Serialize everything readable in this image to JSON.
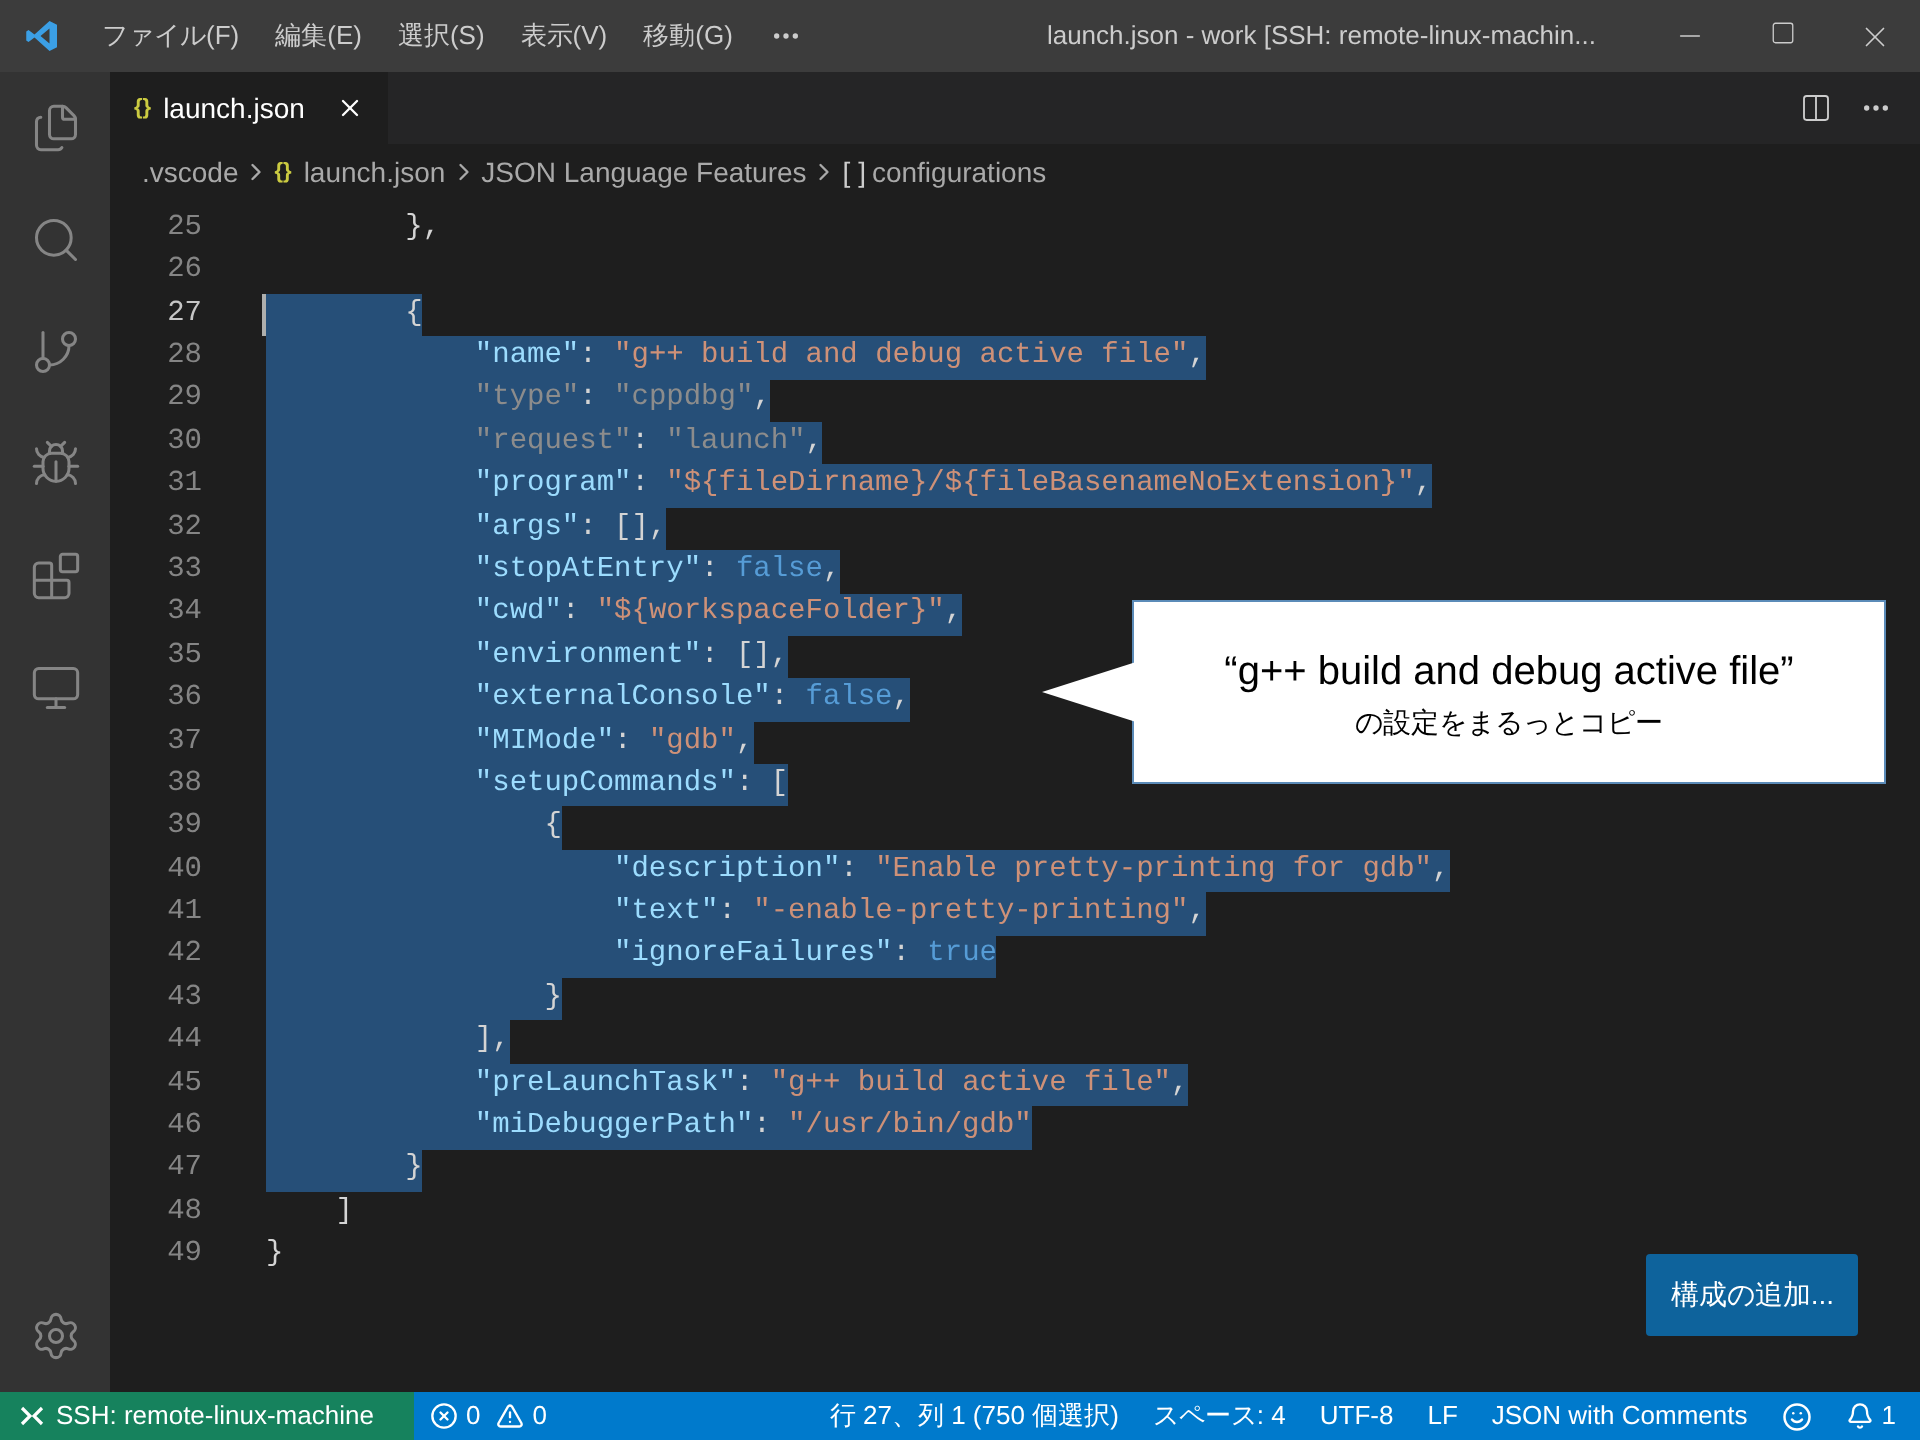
{
  "menu": [
    "ファイル(F)",
    "編集(E)",
    "選択(S)",
    "表示(V)",
    "移動(G)"
  ],
  "window": {
    "title": "launch.json - work [SSH: remote-linux-machin..."
  },
  "tabs": [
    {
      "label": "launch.json",
      "icon": "{}",
      "selected": true
    }
  ],
  "breadcrumbs": [
    {
      "label": ".vscode"
    },
    {
      "label": "launch.json",
      "icon": "{}"
    },
    {
      "label": "JSON Language Features"
    },
    {
      "label": "configurations",
      "icon": "[ ]"
    }
  ],
  "lines": [
    {
      "number": "25",
      "current": false,
      "selected": false,
      "tokens": [
        {
          "kind": "punct",
          "text": "        },"
        }
      ]
    },
    {
      "number": "26",
      "current": false,
      "selected": false
    },
    {
      "number": "27",
      "current": true,
      "selected": true,
      "tokens": [
        {
          "kind": "punct",
          "text": "        {"
        }
      ]
    },
    {
      "number": "28",
      "current": false,
      "selected": true,
      "tokens": [
        {
          "kind": "key",
          "text": "            \"name\""
        },
        {
          "kind": "punct",
          "text": ": "
        },
        {
          "kind": "string",
          "text": "\"g++ build and debug active file\""
        },
        {
          "kind": "punct",
          "text": ","
        }
      ]
    },
    {
      "number": "29",
      "current": false,
      "selected": true,
      "tokens": [
        {
          "kind": "dim",
          "text": "            \"type\""
        },
        {
          "kind": "punct",
          "text": ": "
        },
        {
          "kind": "dim",
          "text": "\"cppdbg\""
        },
        {
          "kind": "punct",
          "text": ","
        }
      ]
    },
    {
      "number": "30",
      "current": false,
      "selected": true,
      "tokens": [
        {
          "kind": "dim",
          "text": "            \"request\""
        },
        {
          "kind": "punct",
          "text": ": "
        },
        {
          "kind": "dim",
          "text": "\"launch\""
        },
        {
          "kind": "punct",
          "text": ","
        }
      ]
    },
    {
      "number": "31",
      "current": false,
      "selected": true,
      "tokens": [
        {
          "kind": "key",
          "text": "            \"program\""
        },
        {
          "kind": "punct",
          "text": ": "
        },
        {
          "kind": "string",
          "text": "\"${fileDirname}/${fileBasenameNoExtension}\""
        },
        {
          "kind": "punct",
          "text": ","
        }
      ]
    },
    {
      "number": "32",
      "current": false,
      "selected": true,
      "tokens": [
        {
          "kind": "key",
          "text": "            \"args\""
        },
        {
          "kind": "punct",
          "text": ": [],"
        }
      ]
    },
    {
      "number": "33",
      "current": false,
      "selected": true,
      "tokens": [
        {
          "kind": "key",
          "text": "            \"stopAtEntry\""
        },
        {
          "kind": "punct",
          "text": ": "
        },
        {
          "kind": "keyword",
          "text": "false"
        },
        {
          "kind": "punct",
          "text": ","
        }
      ]
    },
    {
      "number": "34",
      "current": false,
      "selected": true,
      "tokens": [
        {
          "kind": "key",
          "text": "            \"cwd\""
        },
        {
          "kind": "punct",
          "text": ": "
        },
        {
          "kind": "string",
          "text": "\"${workspaceFolder}\""
        },
        {
          "kind": "punct",
          "text": ","
        }
      ]
    },
    {
      "number": "35",
      "current": false,
      "selected": true,
      "tokens": [
        {
          "kind": "key",
          "text": "            \"environment\""
        },
        {
          "kind": "punct",
          "text": ": [],"
        }
      ]
    },
    {
      "number": "36",
      "current": false,
      "selected": true,
      "tokens": [
        {
          "kind": "key",
          "text": "            \"externalConsole\""
        },
        {
          "kind": "punct",
          "text": ": "
        },
        {
          "kind": "keyword",
          "text": "false"
        },
        {
          "kind": "punct",
          "text": ","
        }
      ]
    },
    {
      "number": "37",
      "current": false,
      "selected": true,
      "tokens": [
        {
          "kind": "key",
          "text": "            \"MIMode\""
        },
        {
          "kind": "punct",
          "text": ": "
        },
        {
          "kind": "string",
          "text": "\"gdb\""
        },
        {
          "kind": "punct",
          "text": ","
        }
      ]
    },
    {
      "number": "38",
      "current": false,
      "selected": true,
      "tokens": [
        {
          "kind": "key",
          "text": "            \"setupCommands\""
        },
        {
          "kind": "punct",
          "text": ": ["
        }
      ]
    },
    {
      "number": "39",
      "current": false,
      "selected": true,
      "tokens": [
        {
          "kind": "punct",
          "text": "                {"
        }
      ]
    },
    {
      "number": "40",
      "current": false,
      "selected": true,
      "tokens": [
        {
          "kind": "key",
          "text": "                    \"description\""
        },
        {
          "kind": "punct",
          "text": ": "
        },
        {
          "kind": "string",
          "text": "\"Enable pretty-printing for gdb\""
        },
        {
          "kind": "punct",
          "text": ","
        }
      ]
    },
    {
      "number": "41",
      "current": false,
      "selected": true,
      "tokens": [
        {
          "kind": "key",
          "text": "                    \"text\""
        },
        {
          "kind": "punct",
          "text": ": "
        },
        {
          "kind": "string",
          "text": "\"-enable-pretty-printing\""
        },
        {
          "kind": "punct",
          "text": ","
        }
      ]
    },
    {
      "number": "42",
      "current": false,
      "selected": true,
      "tokens": [
        {
          "kind": "key",
          "text": "                    \"ignoreFailures\""
        },
        {
          "kind": "punct",
          "text": ": "
        },
        {
          "kind": "keyword",
          "text": "true"
        }
      ]
    },
    {
      "number": "43",
      "current": false,
      "selected": true,
      "tokens": [
        {
          "kind": "punct",
          "text": "                }"
        }
      ]
    },
    {
      "number": "44",
      "current": false,
      "selected": true,
      "tokens": [
        {
          "kind": "punct",
          "text": "            ],"
        }
      ]
    },
    {
      "number": "45",
      "current": false,
      "selected": true,
      "tokens": [
        {
          "kind": "key",
          "text": "            \"preLaunchTask\""
        },
        {
          "kind": "punct",
          "text": ": "
        },
        {
          "kind": "string",
          "text": "\"g++ build active file\""
        },
        {
          "kind": "punct",
          "text": ","
        }
      ]
    },
    {
      "number": "46",
      "current": false,
      "selected": true,
      "tokens": [
        {
          "kind": "key",
          "text": "            \"miDebuggerPath\""
        },
        {
          "kind": "punct",
          "text": ": "
        },
        {
          "kind": "string",
          "text": "\"/usr/bin/gdb\""
        }
      ]
    },
    {
      "number": "47",
      "current": false,
      "selected": true,
      "tokens": [
        {
          "kind": "punct",
          "text": "        }"
        }
      ]
    },
    {
      "number": "48",
      "current": false,
      "selected": false,
      "tokens": [
        {
          "kind": "punct",
          "text": "    ]"
        }
      ]
    },
    {
      "number": "49",
      "current": false,
      "selected": false,
      "tokens": [
        {
          "kind": "punct",
          "text": "}"
        }
      ]
    }
  ],
  "callout": {
    "title": "“g++ build and debug active file”",
    "text": "の設定をまるっとコピー"
  },
  "add_configuration_button": "構成の追加...",
  "status_bar": {
    "remote": "SSH: remote-linux-machine",
    "errors": "0",
    "warnings": "0",
    "position": "行 27、列 1 (750 個選択)",
    "indent": "スペース: 4",
    "encoding": "UTF-8",
    "eol": "LF",
    "language": "JSON with Comments",
    "notifications": "1"
  }
}
